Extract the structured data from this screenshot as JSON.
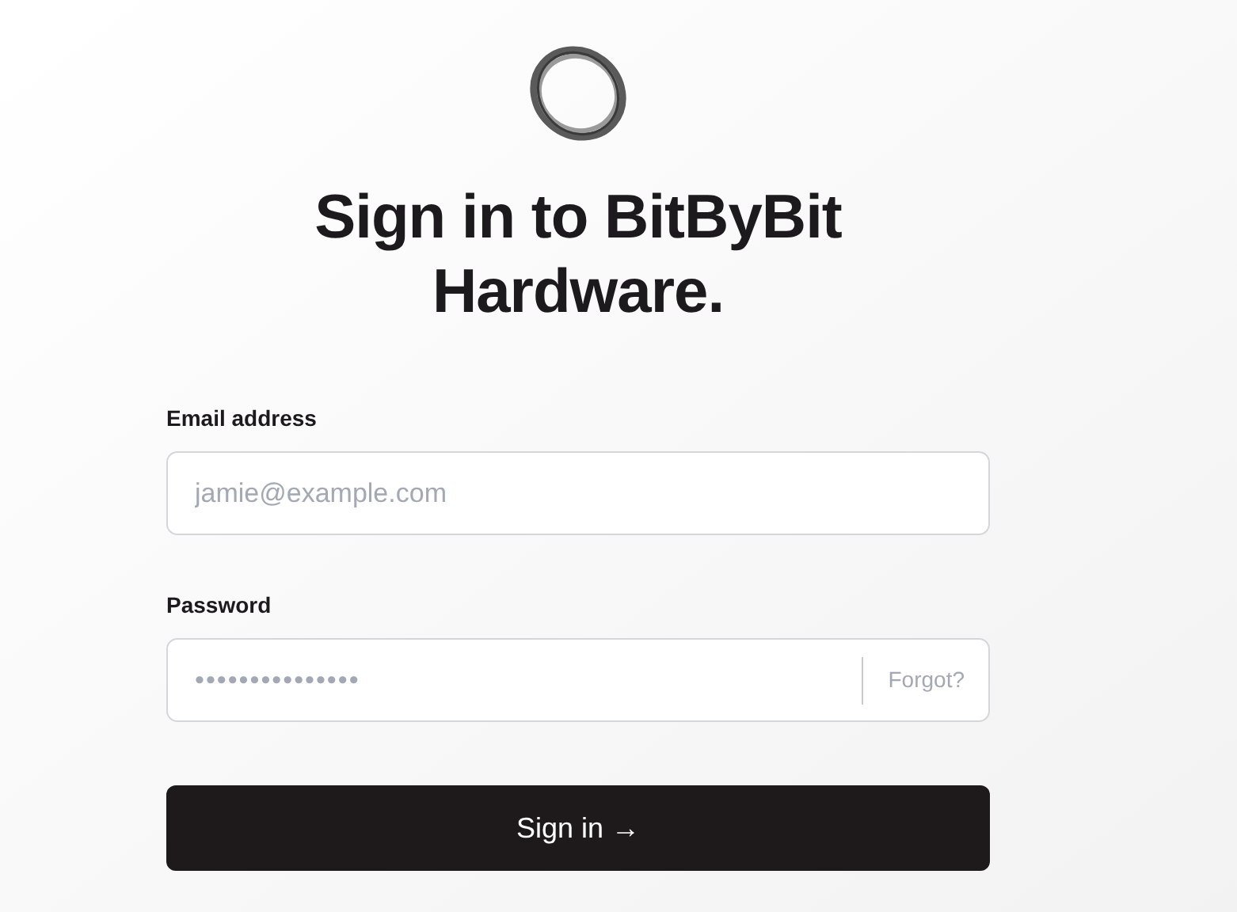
{
  "title": "Sign in to BitByBit Hardware.",
  "fields": [
    {
      "label": "Email address",
      "placeholder": "jamie@example.com",
      "kind": "email"
    },
    {
      "label": "Password",
      "placeholder": "•••••••••••••••",
      "kind": "password",
      "link": "Forgot?"
    }
  ],
  "submit": {
    "label": "Sign in",
    "arrow": "→"
  }
}
